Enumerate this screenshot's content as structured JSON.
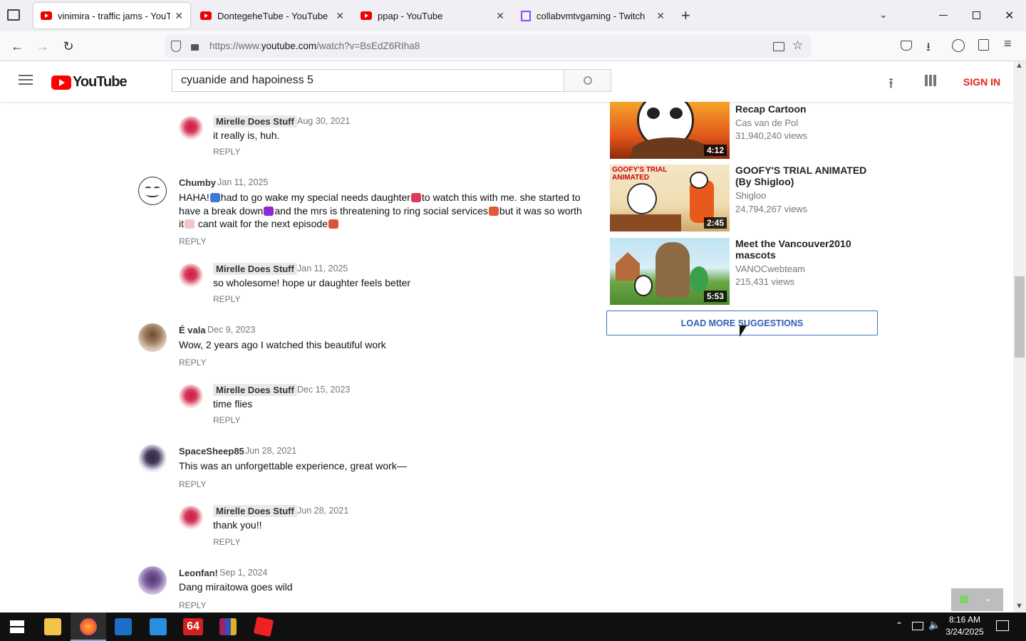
{
  "browser": {
    "tabs": [
      {
        "title": "vinimira - traffic jams - YouTube",
        "icon": "youtube-favicon",
        "active": true
      },
      {
        "title": "DontegeheTube - YouTube",
        "icon": "youtube-favicon",
        "active": false
      },
      {
        "title": "ppap - YouTube",
        "icon": "youtube-favicon",
        "active": false
      },
      {
        "title": "collabvmtvgaming - Twitch",
        "icon": "twitch-favicon",
        "active": false
      }
    ],
    "url_prefix": "https://www.",
    "url_domain": "youtube.com",
    "url_rest": "/watch?v=BsEdZ6RIha8"
  },
  "youtube": {
    "logo_text": "YouTube",
    "search_value": "cyuanide and hapoiness 5",
    "sign_in": "SIGN IN"
  },
  "comments": [
    {
      "author": "Mirelle Does Stuff",
      "date": "Aug 30, 2021",
      "text": "it really is, huh.",
      "reply": "REPLY",
      "is_reply": true
    },
    {
      "author": "Chumby",
      "date": "Jan 11, 2025",
      "text_parts": [
        "HAHA!",
        "had to go wake my special needs daughter",
        "to watch this with me. she started to",
        "have a break down",
        "and the mrs is threatening to ring social services",
        "but it was so worth",
        "it",
        " cant wait for the next episode"
      ],
      "reply": "REPLY",
      "is_reply": false
    },
    {
      "author": "Mirelle Does Stuff",
      "date": "Jan 11, 2025",
      "text": "so wholesome! hope ur daughter feels better",
      "reply": "REPLY",
      "is_reply": true
    },
    {
      "author": "É vala",
      "date": "Dec 9, 2023",
      "text": "Wow, 2 years ago I watched this beautiful work",
      "reply": "REPLY",
      "is_reply": false
    },
    {
      "author": "Mirelle Does Stuff",
      "date": "Dec 15, 2023",
      "text": "time flies",
      "reply": "REPLY",
      "is_reply": true
    },
    {
      "author": "SpaceSheep85",
      "date": "Jun 28, 2021",
      "text": "This was an unforgettable experience, great work—",
      "reply": "REPLY",
      "is_reply": false
    },
    {
      "author": "Mirelle Does Stuff",
      "date": "Jun 28, 2021",
      "text": "thank you!!",
      "reply": "REPLY",
      "is_reply": true
    },
    {
      "author": "Leonfan!",
      "date": "Sep 1, 2024",
      "text": "Dang miraitowa goes wild",
      "reply": "REPLY",
      "is_reply": false
    }
  ],
  "suggestions": [
    {
      "title": "Recap Cartoon",
      "channel": "Cas van de Pol",
      "views": "31,940,240 views",
      "duration": "4:12"
    },
    {
      "title": "GOOFY'S TRIAL ANIMATED (By Shigloo)",
      "channel": "Shigloo",
      "views": "24,794,267 views",
      "duration": "2:45",
      "thumb_text": "GOOFY'S TRIAL ANIMATED"
    },
    {
      "title": "Meet the Vancouver2010 mascots",
      "channel": "VANOCwebteam",
      "views": "215,431 views",
      "duration": "5:53"
    }
  ],
  "load_more": "LOAD MORE SUGGESTIONS",
  "taskbar": {
    "time": "8:16 AM",
    "date": "3/24/2025",
    "app_64_label": "64"
  },
  "colors": {
    "youtube_red": "#ff0000",
    "sign_in_red": "#e62117",
    "link_blue": "#3160b5"
  }
}
